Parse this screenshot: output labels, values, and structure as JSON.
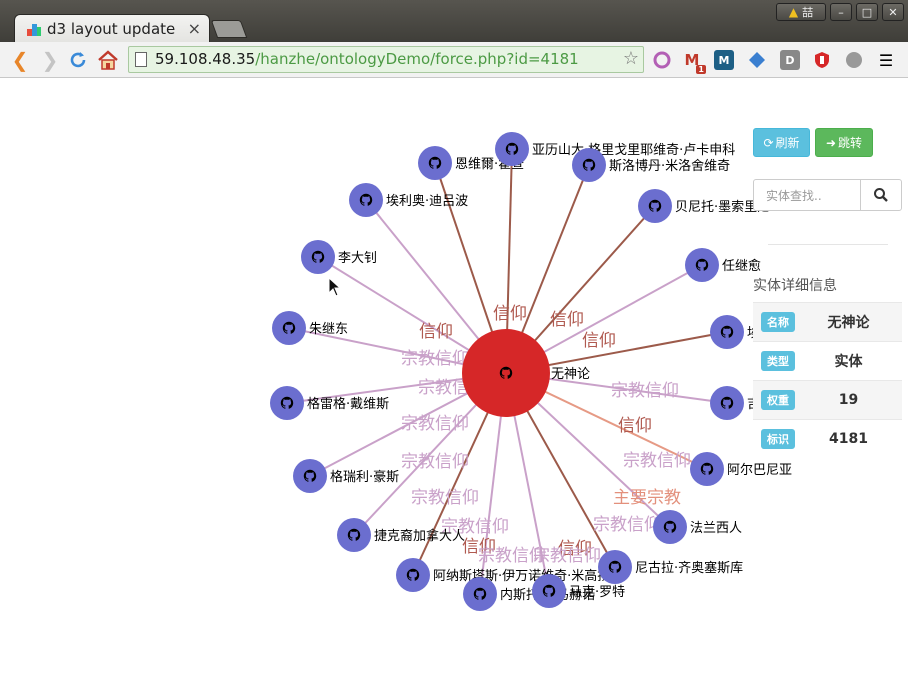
{
  "browser": {
    "tab_title": "d3 layout update",
    "tab_close": "×",
    "url_host": "59.108.48.35",
    "url_path": "/hanzhe/ontologyDemo/force.php?id=4181",
    "user_label": "喆",
    "window_buttons": [
      "–",
      "□",
      "✕"
    ],
    "ext_badge": "1"
  },
  "toolbar": {
    "refresh_label": "刷新",
    "jump_label": "跳转",
    "search_placeholder": "实体查找.."
  },
  "info_panel": {
    "title": "实体详细信息",
    "rows": [
      {
        "key": "名称",
        "value": "无神论"
      },
      {
        "key": "类型",
        "value": "实体"
      },
      {
        "key": "权重",
        "value": "19"
      },
      {
        "key": "标识",
        "value": "4181"
      }
    ]
  },
  "graph": {
    "center": {
      "label": "无神论",
      "color": "#d62728"
    },
    "node_color": "#6b6ecf",
    "edge_colors": {
      "信仰": "#9c5a4a",
      "宗教信仰": "#c9a1c9",
      "主要宗教": "#e69a85"
    },
    "label_colors": {
      "信仰": "#b05a50",
      "宗教信仰": "#c9a1c9",
      "主要宗教": "#e3907c"
    },
    "nodes": [
      {
        "label": "恩维爾·霍查",
        "rel": "信仰"
      },
      {
        "label": "亚历山大·格里戈里耶维奇·卢卡申科",
        "rel": "信仰"
      },
      {
        "label": "斯洛博丹·米洛舍维奇",
        "rel": "信仰"
      },
      {
        "label": "埃利奥·迪吕波",
        "rel": "宗教信仰"
      },
      {
        "label": "贝尼托·墨索里尼",
        "rel": "信仰"
      },
      {
        "label": "李大钊",
        "rel": "宗教信仰"
      },
      {
        "label": "任继愈",
        "rel": "宗教信仰"
      },
      {
        "label": "朱继东",
        "rel": "宗教信仰"
      },
      {
        "label": "埃",
        "rel": "信仰"
      },
      {
        "label": "格雷格·戴维斯",
        "rel": "宗教信仰"
      },
      {
        "label": "吉",
        "rel": "宗教信仰"
      },
      {
        "label": "格瑞利·豪斯",
        "rel": "宗教信仰"
      },
      {
        "label": "阿尔巴尼亚",
        "rel": "主要宗教"
      },
      {
        "label": "捷克裔加拿大人",
        "rel": "宗教信仰"
      },
      {
        "label": "法兰西人",
        "rel": "宗教信仰"
      },
      {
        "label": "阿纳斯塔斯·伊万诺维奇·米高扬",
        "rel": "信仰"
      },
      {
        "label": "尼古拉·齐奥塞斯库",
        "rel": "信仰"
      },
      {
        "label": "内斯托尔·马赫诺",
        "rel": "宗教信仰"
      },
      {
        "label": "马克·罗特",
        "rel": "宗教信仰"
      }
    ]
  }
}
